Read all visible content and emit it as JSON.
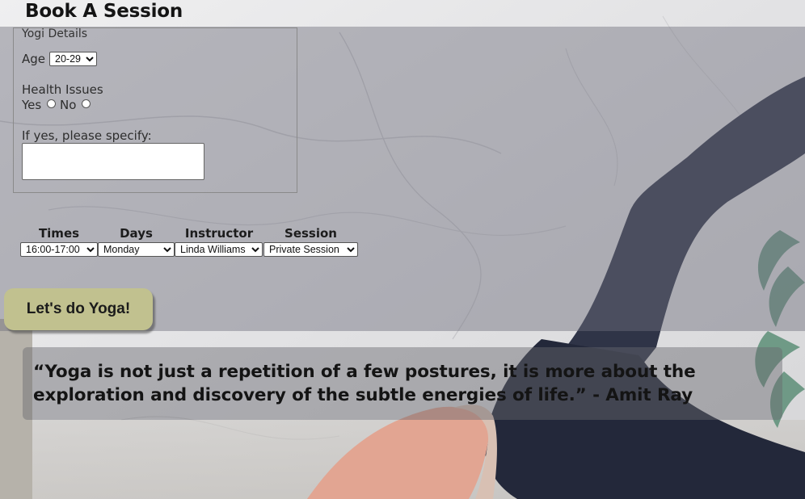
{
  "page": {
    "title": "Book A Session"
  },
  "yogi_details": {
    "legend": "Yogi Details",
    "age_label": "Age",
    "age_selected": "20-29",
    "health_label": "Health Issues",
    "yes_label": "Yes",
    "no_label": "No",
    "specify_label": "If yes, please specify:",
    "specify_value": ""
  },
  "schedule": {
    "headers": {
      "times": "Times",
      "days": "Days",
      "instructor": "Instructor",
      "session": "Session"
    },
    "times_selected": "16:00-17:00",
    "days_selected": "Monday",
    "instructor_selected": "Linda Williams",
    "session_selected": "Private Session"
  },
  "submit_label": "Let's do Yoga!",
  "quote": "“Yoga is not just a repetition of a few postures, it is more about the exploration and discovery of the subtle energies of life.” - Amit Ray",
  "colors": {
    "button_bg": "#c1c18f",
    "overlay": "#6e6e7d",
    "legging": "#2e3346",
    "top": "#e0a38f"
  }
}
